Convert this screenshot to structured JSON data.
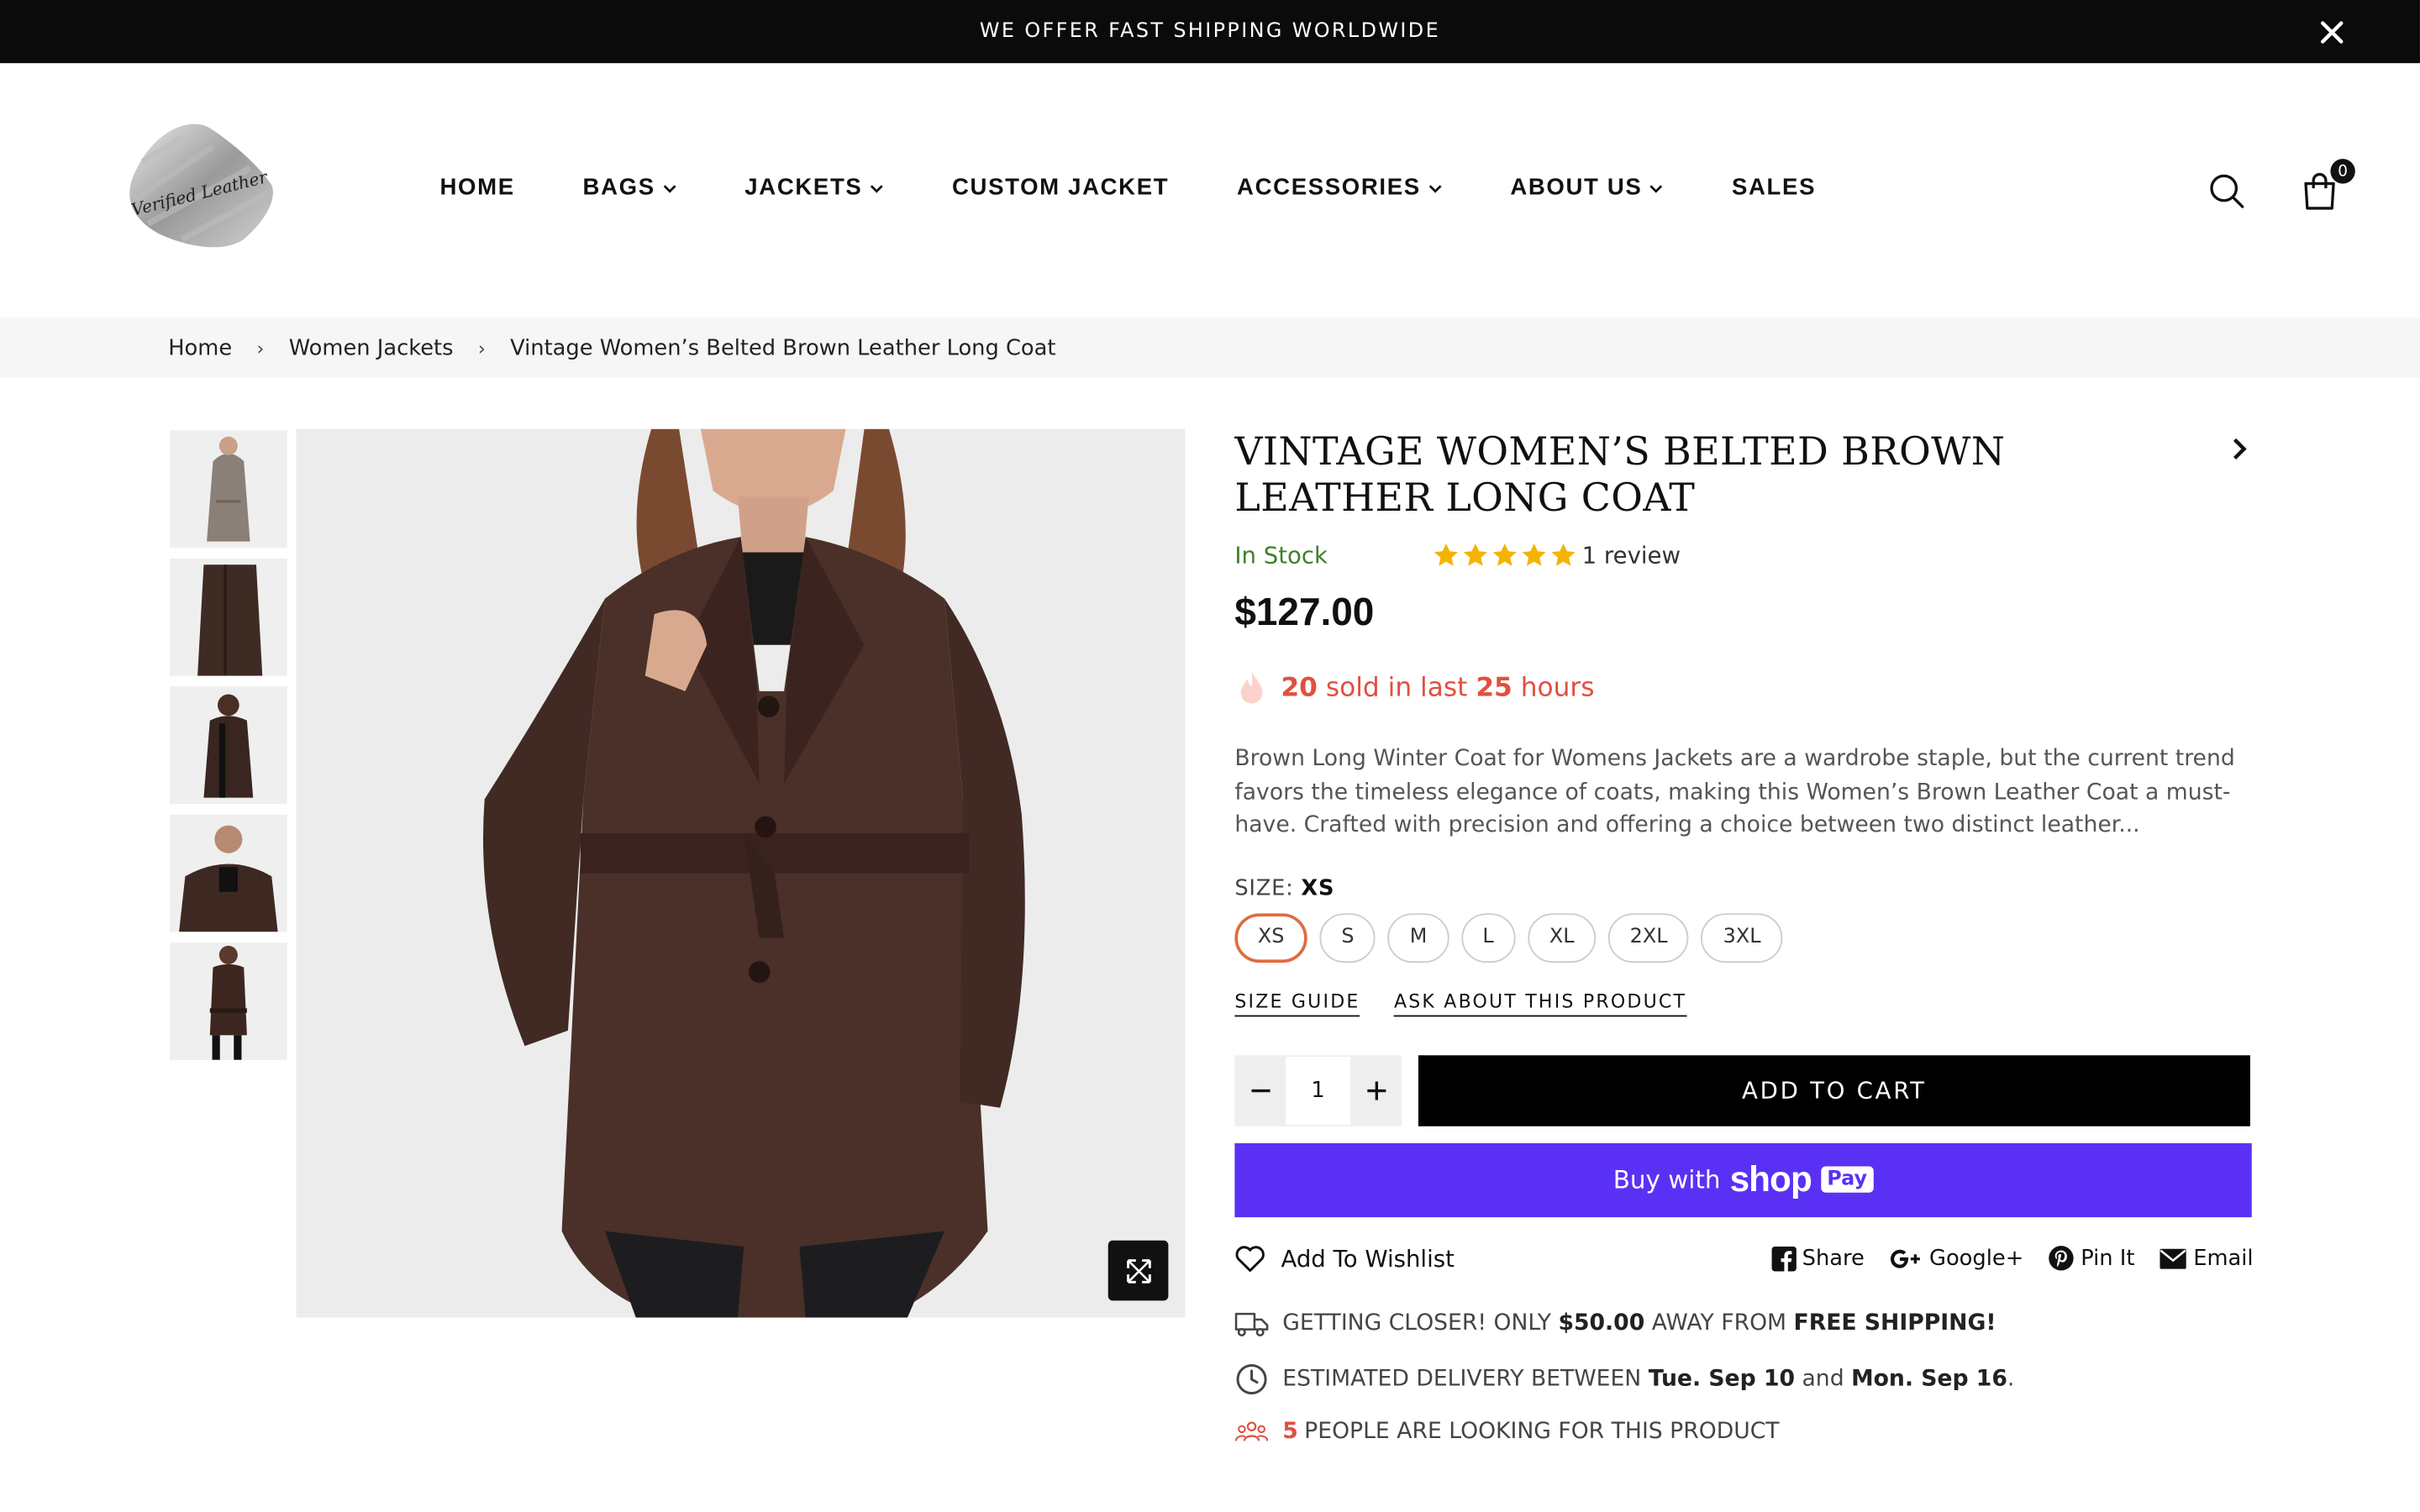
{
  "announcement": {
    "text": "WE OFFER FAST SHIPPING WORLDWIDE"
  },
  "header": {
    "logo_text": "Verified Leather",
    "nav": [
      {
        "label": "HOME",
        "has_dropdown": false
      },
      {
        "label": "BAGS",
        "has_dropdown": true
      },
      {
        "label": "JACKETS",
        "has_dropdown": true
      },
      {
        "label": "CUSTOM JACKET",
        "has_dropdown": false
      },
      {
        "label": "ACCESSORIES",
        "has_dropdown": true
      },
      {
        "label": "ABOUT US",
        "has_dropdown": true
      },
      {
        "label": "SALES",
        "has_dropdown": false
      }
    ],
    "cart_count": "0"
  },
  "breadcrumb": {
    "items": [
      "Home",
      "Women Jackets",
      "Vintage Women’s Belted Brown Leather Long Coat"
    ],
    "separator": "›"
  },
  "product": {
    "title": "VINTAGE WOMEN’S BELTED BROWN LEATHER LONG COAT",
    "stock": "In Stock",
    "rating": 5,
    "review_text": "1 review",
    "price": "$127.00",
    "sold": {
      "count": "20",
      "mid": "sold in last",
      "hours": "25",
      "suffix": "hours"
    },
    "description": "Brown Long Winter Coat for Womens Jackets are a wardrobe staple, but the current trend favors the timeless elegance of coats, making this Women’s Brown Leather Coat a must-have. Crafted with precision and offering a choice between two distinct leather...",
    "size_label": "SIZE:",
    "selected_size": "XS",
    "sizes": [
      "XS",
      "S",
      "M",
      "L",
      "XL",
      "2XL",
      "3XL"
    ],
    "size_guide": "SIZE GUIDE",
    "ask": "ASK ABOUT THIS PRODUCT",
    "quantity": "1",
    "add_to_cart": "ADD TO CART",
    "shoppay": {
      "buy_with": "Buy with",
      "shop": "shop",
      "pay": "Pay"
    },
    "wishlist": "Add To Wishlist",
    "shares": [
      "Share",
      "Google+",
      "Pin It",
      "Email"
    ],
    "perks": {
      "shipping": {
        "pre": "GETTING CLOSER! ONLY",
        "amount": "$50.00",
        "mid": "AWAY FROM",
        "bold": "FREE SHIPPING!"
      },
      "delivery": {
        "pre": "ESTIMATED DELIVERY BETWEEN",
        "from": "Tue. Sep 10",
        "and": "and",
        "to": "Mon. Sep 16",
        "end": "."
      },
      "watching": {
        "count": "5",
        "text": "PEOPLE ARE LOOKING FOR THIS PRODUCT"
      }
    }
  },
  "colors": {
    "accent": "#e05040",
    "shoppay": "#5a31f4",
    "in_stock": "#3e7f2a",
    "star": "#f5b301"
  }
}
